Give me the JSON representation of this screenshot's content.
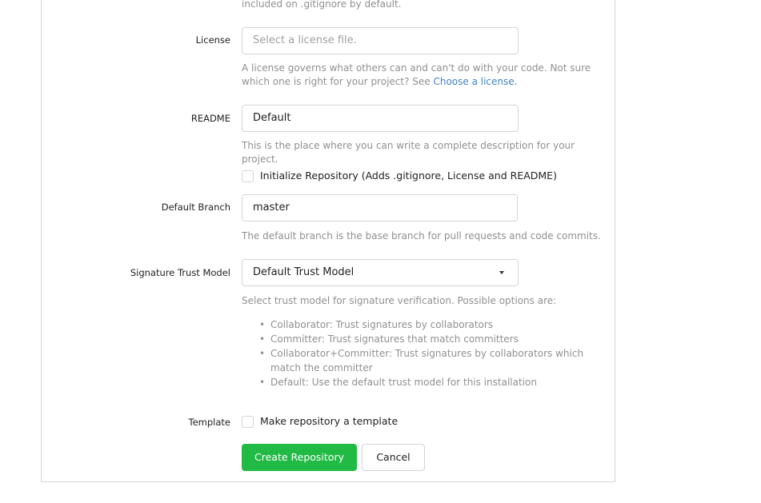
{
  "gitignore": {
    "help_tail": "included on .gitignore by default."
  },
  "license": {
    "label": "License",
    "placeholder": "Select a license file.",
    "help": "A license governs what others can and can't do with your code. Not sure which one is right for your project? See ",
    "help_link": "Choose a license."
  },
  "readme": {
    "label": "README",
    "value": "Default",
    "help": "This is the place where you can write a complete description for your project."
  },
  "init_repo": {
    "label": "Initialize Repository (Adds .gitignore, License and README)",
    "checked": false
  },
  "default_branch": {
    "label": "Default Branch",
    "value": "master",
    "help": "The default branch is the base branch for pull requests and code commits."
  },
  "trust_model": {
    "label": "Signature Trust Model",
    "value": "Default Trust Model",
    "help": "Select trust model for signature verification. Possible options are:",
    "options": [
      "Collaborator: Trust signatures by collaborators",
      "Committer: Trust signatures that match committers",
      "Collaborator+Committer: Trust signatures by collaborators which match the committer",
      "Default: Use the default trust model for this installation"
    ]
  },
  "template": {
    "label": "Template",
    "checkbox_label": "Make repository a template",
    "checked": false
  },
  "buttons": {
    "create": "Create Repository",
    "cancel": "Cancel"
  },
  "colors": {
    "primary": "#21ba45",
    "link": "#4183c4"
  }
}
